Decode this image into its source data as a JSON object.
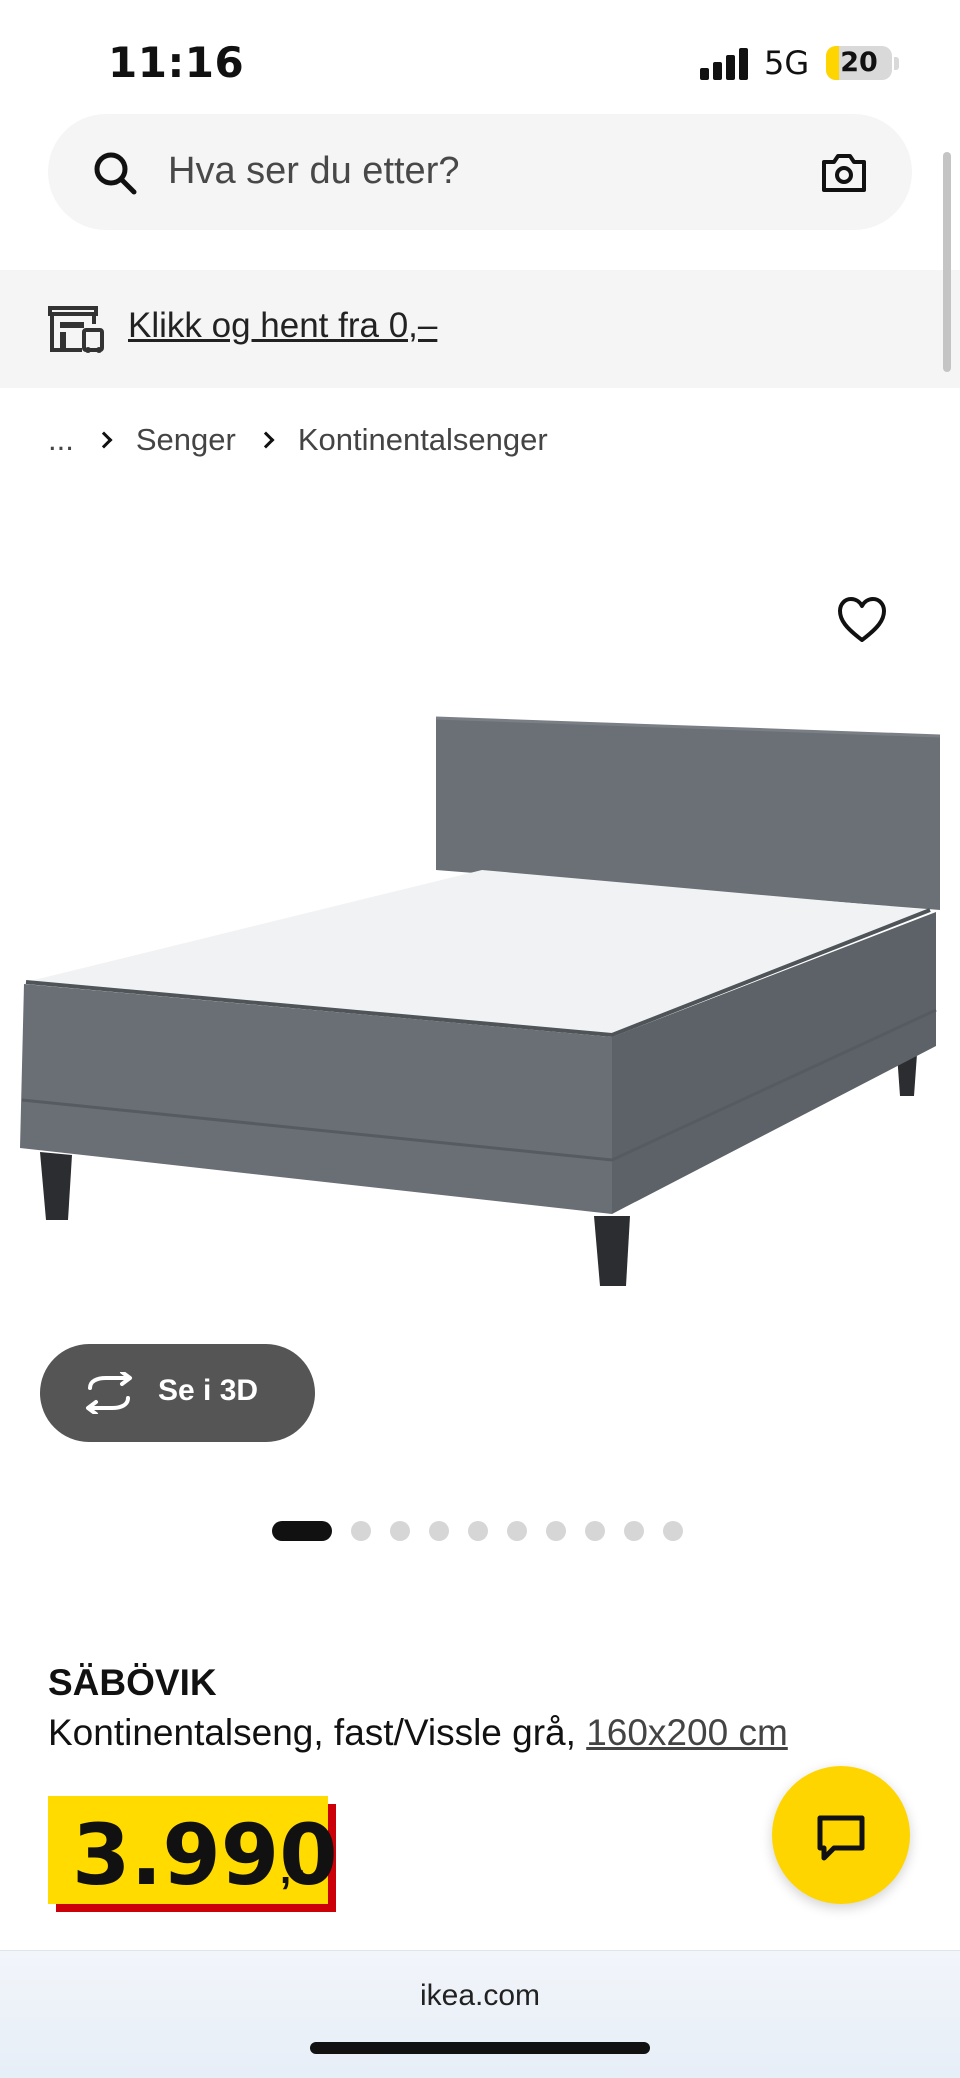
{
  "status_bar": {
    "time": "11:16",
    "network": "5G",
    "battery_level": "20",
    "battery_percent": 20
  },
  "search": {
    "placeholder": "Hva ser du etter?"
  },
  "promo": {
    "link_text": "Klikk og hent fra 0,–"
  },
  "breadcrumb": {
    "items": [
      "...",
      "Senger",
      "Kontinentalsenger"
    ]
  },
  "product": {
    "view_3d_label": "Se i 3D",
    "carousel": {
      "total": 10,
      "active": 1
    },
    "name": "SÄBÖVIK",
    "description": "Kontinentalseng, fast/Vissle grå,",
    "size": "160x200 cm",
    "price": "3.990",
    "price_suffix": ",-"
  },
  "browser": {
    "url": "ikea.com"
  },
  "colors": {
    "accent_yellow": "#ffdb00",
    "price_shadow_red": "#cc0008",
    "bed_fabric": "#6b7076"
  }
}
